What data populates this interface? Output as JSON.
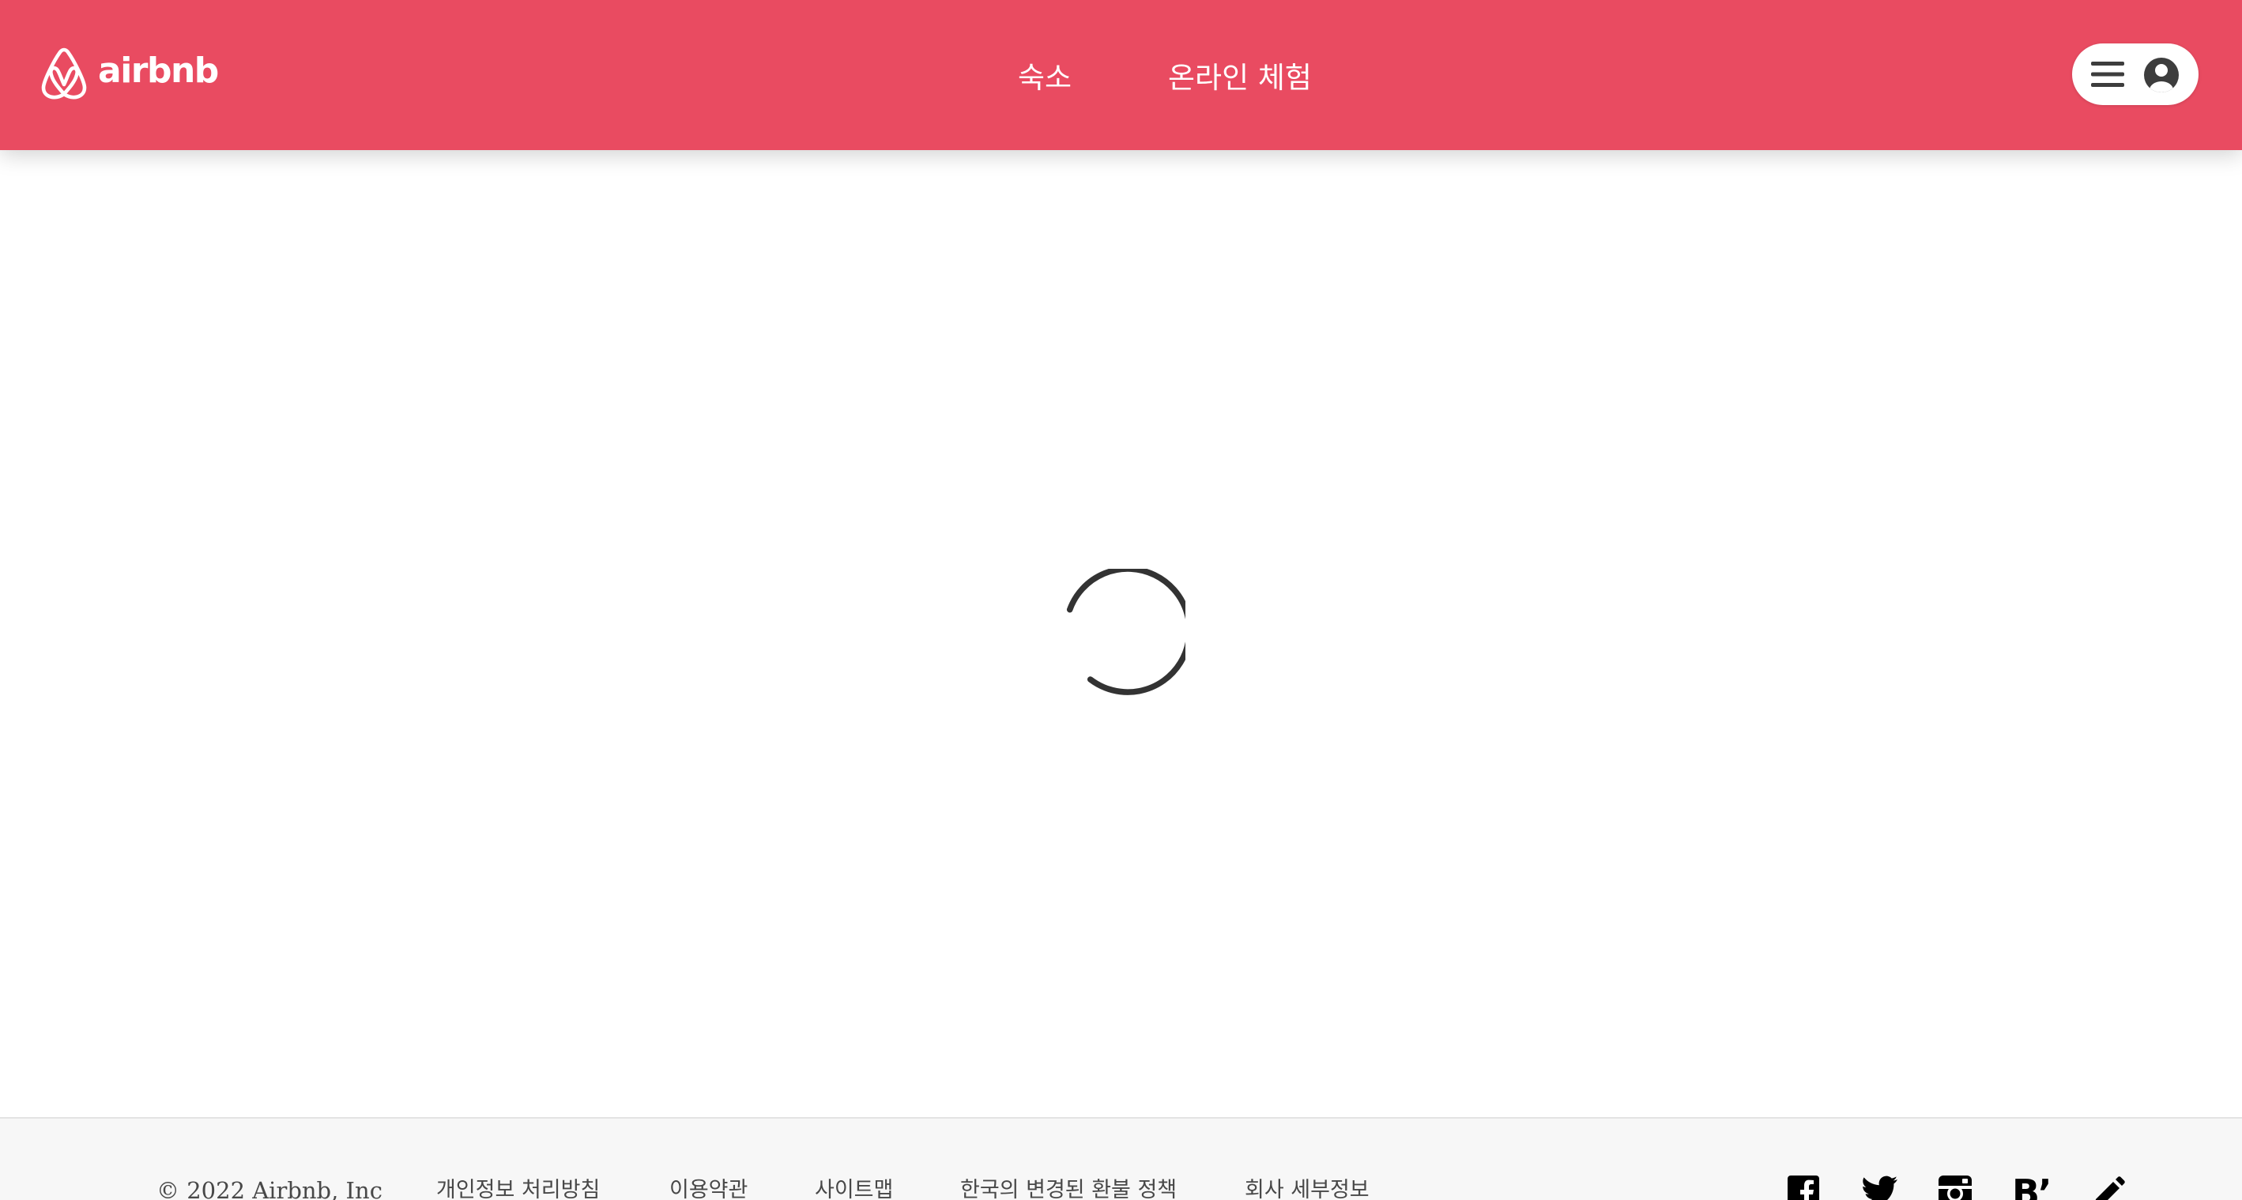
{
  "colors": {
    "brand": "#e94b61",
    "header_text": "#ffffff",
    "spinner": "#333333",
    "footer_background": "#f7f7f7",
    "footer_text": "#484848"
  },
  "header": {
    "logo_icon": "airbnb-belo-icon",
    "logo_text": "airbnb",
    "nav": [
      {
        "label": "숙소"
      },
      {
        "label": "온라인 체험"
      }
    ],
    "user_menu": {
      "menu_icon": "hamburger-icon",
      "avatar_icon": "user-avatar-icon"
    }
  },
  "main": {
    "loading_icon": "loading-spinner-icon"
  },
  "footer": {
    "copyright": "© 2022 Airbnb, Inc",
    "links": [
      {
        "label": "개인정보 처리방침"
      },
      {
        "label": "이용약관"
      },
      {
        "label": "사이트맵"
      },
      {
        "label": "한국의 변경된 환불 정책"
      },
      {
        "label": "회사 세부정보"
      }
    ],
    "social": [
      {
        "icon": "facebook-icon"
      },
      {
        "icon": "twitter-icon"
      },
      {
        "icon": "instagram-icon"
      },
      {
        "icon": "behance-icon",
        "text": "B’"
      },
      {
        "icon": "pencil-icon"
      }
    ]
  }
}
